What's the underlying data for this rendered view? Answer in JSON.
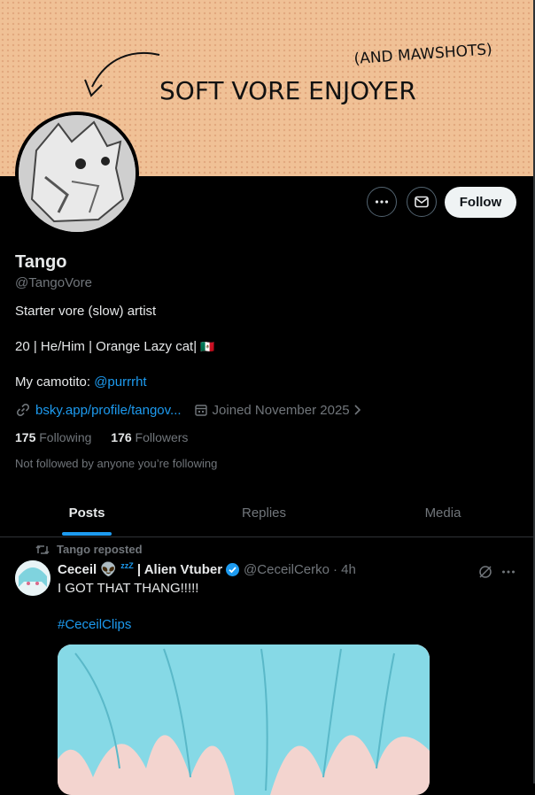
{
  "banner": {
    "text_main": "SOFT VORE ENJOYER",
    "text_side": "(AND MAWSHOTS)",
    "bg_color": "#f0c196"
  },
  "header_actions": {
    "more_icon": "more-horizontal-icon",
    "message_icon": "envelope-icon",
    "follow_label": "Follow"
  },
  "profile": {
    "name": "Tango",
    "handle": "@TangoVore",
    "bio_line1": "Starter vore (slow) artist",
    "bio_line2": "20 | He/Him | Orange Lazy cat|",
    "bio_line2_flag": "🇲🇽",
    "bio_line3_prefix": "My camotito: ",
    "bio_line3_mention": "@purrrht",
    "website": "bsky.app/profile/tangov...",
    "joined": "Joined November 2025",
    "following_count": "175",
    "following_label": "Following",
    "followers_count": "176",
    "followers_label": "Followers",
    "not_followed": "Not followed by anyone you’re following"
  },
  "tabs": [
    {
      "label": "Posts"
    },
    {
      "label": "Replies"
    },
    {
      "label": "Media"
    }
  ],
  "post": {
    "repost_label": "Tango reposted",
    "author_name": "Ceceil 👽 ",
    "author_zzz": "zzZ",
    "author_suffix": " | Alien Vtuber",
    "author_handle": "@CeceilCerko",
    "time": "· 4h",
    "text": "I GOT THAT THANG!!!!!",
    "hashtag": "#CeceilClips"
  },
  "colors": {
    "accent": "#1d9bf0",
    "muted": "#71767b",
    "text": "#e7e9ea",
    "verified": "#1d9bf0"
  }
}
